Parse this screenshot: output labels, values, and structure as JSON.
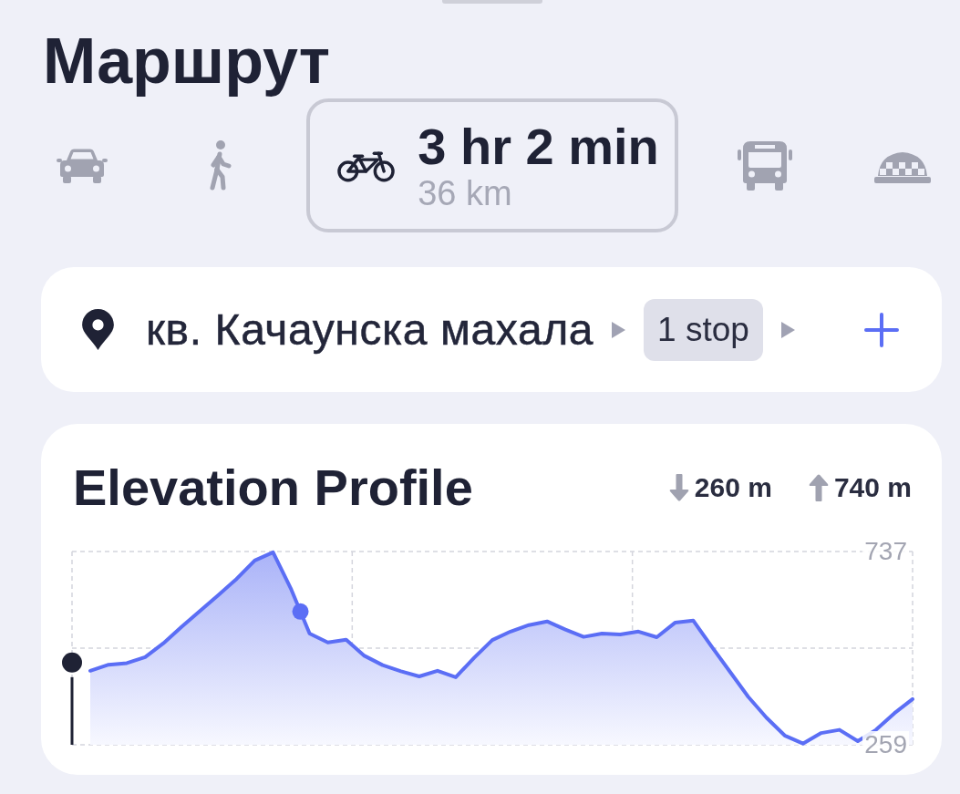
{
  "title": "Маршрут",
  "modes": [
    {
      "kind": "car",
      "selected": false
    },
    {
      "kind": "walk",
      "selected": false
    },
    {
      "kind": "bike",
      "selected": true,
      "duration": "3 hr 2 min",
      "distance": "36 km"
    },
    {
      "kind": "bus",
      "selected": false
    },
    {
      "kind": "taxi",
      "selected": false
    }
  ],
  "route": {
    "destination": "кв. Качаунска махала",
    "stops": "1 stop"
  },
  "elevation": {
    "title": "Elevation Profile",
    "descent": "260 m",
    "ascent": "740 m",
    "chart_data": {
      "type": "area",
      "ylim": [
        259,
        737
      ],
      "yticks": [
        259,
        737
      ],
      "values": [
        null,
        442,
        457,
        461,
        476,
        510,
        551,
        590,
        629,
        669,
        715,
        735,
        643,
        534,
        512,
        519,
        479,
        456,
        441,
        428,
        442,
        426,
        474,
        518,
        539,
        555,
        564,
        544,
        526,
        534,
        532,
        539,
        525,
        561,
        566,
        502,
        440,
        378,
        326,
        282,
        262,
        288,
        296,
        268,
        296,
        337,
        372
      ]
    }
  }
}
